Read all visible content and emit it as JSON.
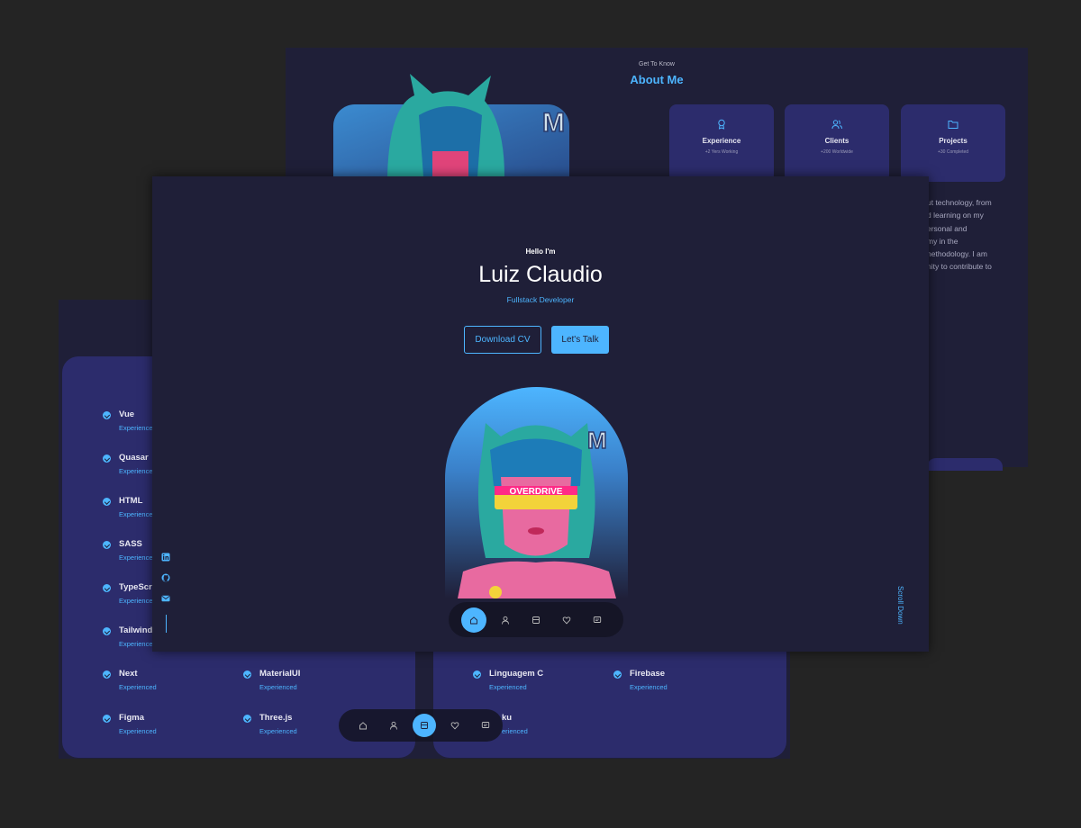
{
  "about": {
    "subtitle": "Get To Know",
    "title": "About Me",
    "cards": [
      {
        "icon": "award-icon",
        "title": "Experience",
        "sub": "+2 Yers Working"
      },
      {
        "icon": "users-icon",
        "title": "Clients",
        "sub": "+200 Worldwide"
      },
      {
        "icon": "folder-icon",
        "title": "Projects",
        "sub": "+30 Completed"
      }
    ],
    "text_lines": [
      "ut technology, from",
      "d learning on my",
      "ersonal and",
      "my in the",
      "nethodology. I am",
      "nity to contribute to"
    ]
  },
  "skills": {
    "left": [
      {
        "name": "Vue",
        "level": "Experienced"
      },
      {
        "name": "Quasar",
        "level": "Experienced"
      },
      {
        "name": "HTML",
        "level": "Experienced"
      },
      {
        "name": "SASS",
        "level": "Experienced"
      },
      {
        "name": "TypeScr",
        "level": "Experienced"
      },
      {
        "name": "Tailwind",
        "level": "Experienced"
      },
      {
        "name": "Next",
        "level": "Experienced"
      },
      {
        "name": "Figma",
        "level": "Experienced"
      }
    ],
    "left_col2": [
      {
        "name": "MaterialUI",
        "level": "Experienced"
      },
      {
        "name": "Three.js",
        "level": "Experienced"
      }
    ],
    "right": [
      {
        "name": "Linguagem C",
        "level": "Experienced"
      },
      {
        "name": "ku",
        "level": "erienced"
      }
    ],
    "right_col2": [
      {
        "name": "Firebase",
        "level": "Experienced"
      }
    ]
  },
  "home": {
    "hello": "Hello I'm",
    "name": "Luiz Claudio",
    "role": "Fullstack Developer",
    "download_cv": "Download CV",
    "lets_talk": "Let's Talk",
    "scroll_down": "Scroll Down",
    "socials": [
      "linkedin-icon",
      "github-icon",
      "mail-icon"
    ]
  },
  "nav": {
    "items": [
      "home-icon",
      "user-icon",
      "book-icon",
      "heart-icon",
      "message-icon"
    ],
    "home_active": 0,
    "skills_active": 2
  },
  "colors": {
    "background": "#242424",
    "panel": "#1f1f38",
    "card": "#2c2c6c",
    "accent": "#4db5ff"
  }
}
